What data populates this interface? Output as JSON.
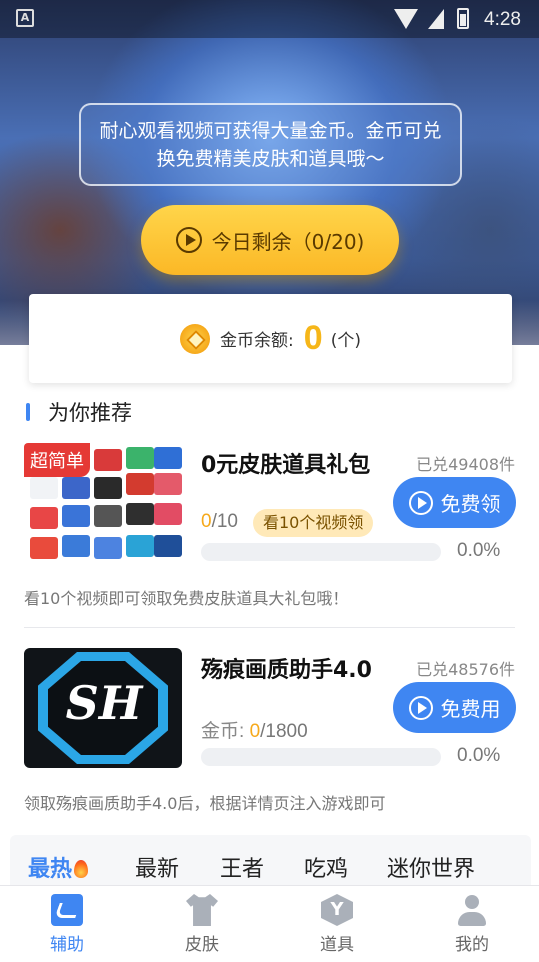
{
  "status_bar": {
    "time": "4:28"
  },
  "hero": {
    "notice": "耐心观看视频可获得大量金币。金币可兑换免费精美皮肤和道具哦～",
    "today_button": "今日剩余（0/20)"
  },
  "coin": {
    "label": "金币余额:",
    "value": "0",
    "unit": "(个)"
  },
  "section": {
    "title": "为你推荐"
  },
  "items": [
    {
      "badge": "超简单",
      "title": "0元皮肤道具礼包",
      "redeemed": "已兑49408件",
      "progress_current": "0",
      "progress_total": "/10",
      "tip": "看10个视频领",
      "percent": "0.0%",
      "progress_fraction": 0,
      "button": "免费领",
      "description": "看10个视频即可领取免费皮肤道具大礼包哦！"
    },
    {
      "thumb_text": "SH",
      "title": "殇痕画质助手4.0",
      "redeemed": "已兑48576件",
      "coin_prefix": "金币: ",
      "progress_current": "0",
      "progress_total": "/1800",
      "percent": "0.0%",
      "progress_fraction": 0,
      "button": "免费用",
      "description": "领取殇痕画质助手4.0后，根据详情页注入游戏即可"
    }
  ],
  "category_tabs": [
    "最热",
    "最新",
    "王者",
    "吃鸡",
    "迷你世界"
  ],
  "bottom_nav": [
    {
      "label": "辅助",
      "icon": "assist-icon",
      "active": true
    },
    {
      "label": "皮肤",
      "icon": "shirt-icon",
      "active": false
    },
    {
      "label": "道具",
      "icon": "box-icon",
      "active": false
    },
    {
      "label": "我的",
      "icon": "user-icon",
      "active": false
    }
  ],
  "colors": {
    "accent": "#3f86f2",
    "gold": "#f6b619",
    "badge_red": "#e53935"
  }
}
